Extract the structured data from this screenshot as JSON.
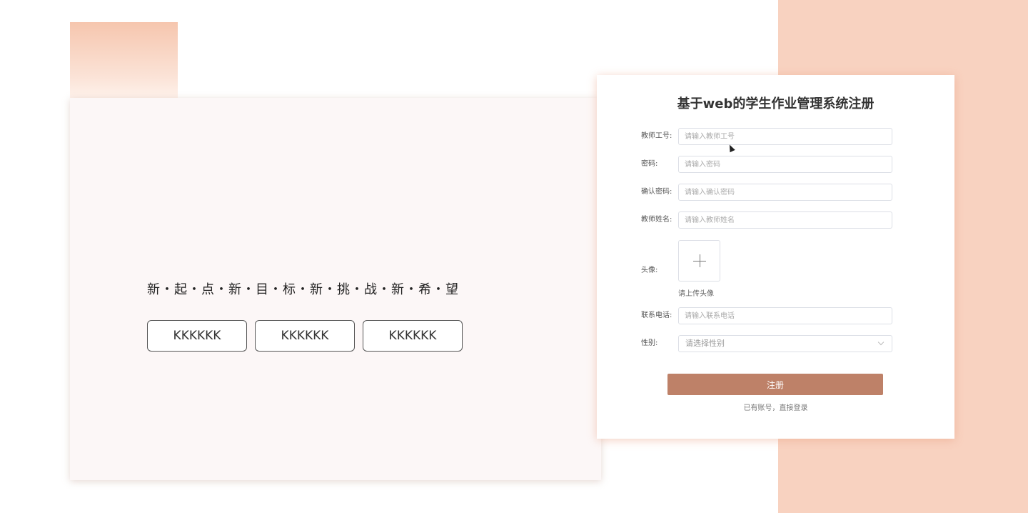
{
  "slogan": "新・起・点・新・目・标・新・挑・战・新・希・望",
  "buttons": [
    "KKKKKK",
    "KKKKKK",
    "KKKKKK"
  ],
  "form": {
    "title": "基于web的学生作业管理系统注册",
    "fields": [
      {
        "label": "教师工号:",
        "placeholder": "请输入教师工号"
      },
      {
        "label": "密码:",
        "placeholder": "请输入密码"
      },
      {
        "label": "确认密码:",
        "placeholder": "请输入确认密码"
      },
      {
        "label": "教师姓名:",
        "placeholder": "请输入教师姓名"
      }
    ],
    "avatar": {
      "label": "头像:",
      "hint": "请上传头像"
    },
    "phone": {
      "label": "联系电话:",
      "placeholder": "请输入联系电话"
    },
    "gender": {
      "label": "性别:",
      "placeholder": "请选择性别"
    },
    "submit_label": "注册",
    "login_link": "已有账号，直接登录"
  },
  "colors": {
    "accent": "#be8168",
    "side_panel": "#f8d2c0"
  },
  "icons": {
    "upload": "plus-icon",
    "dropdown": "chevron-down-icon",
    "pointer": "mouse-cursor-icon"
  }
}
